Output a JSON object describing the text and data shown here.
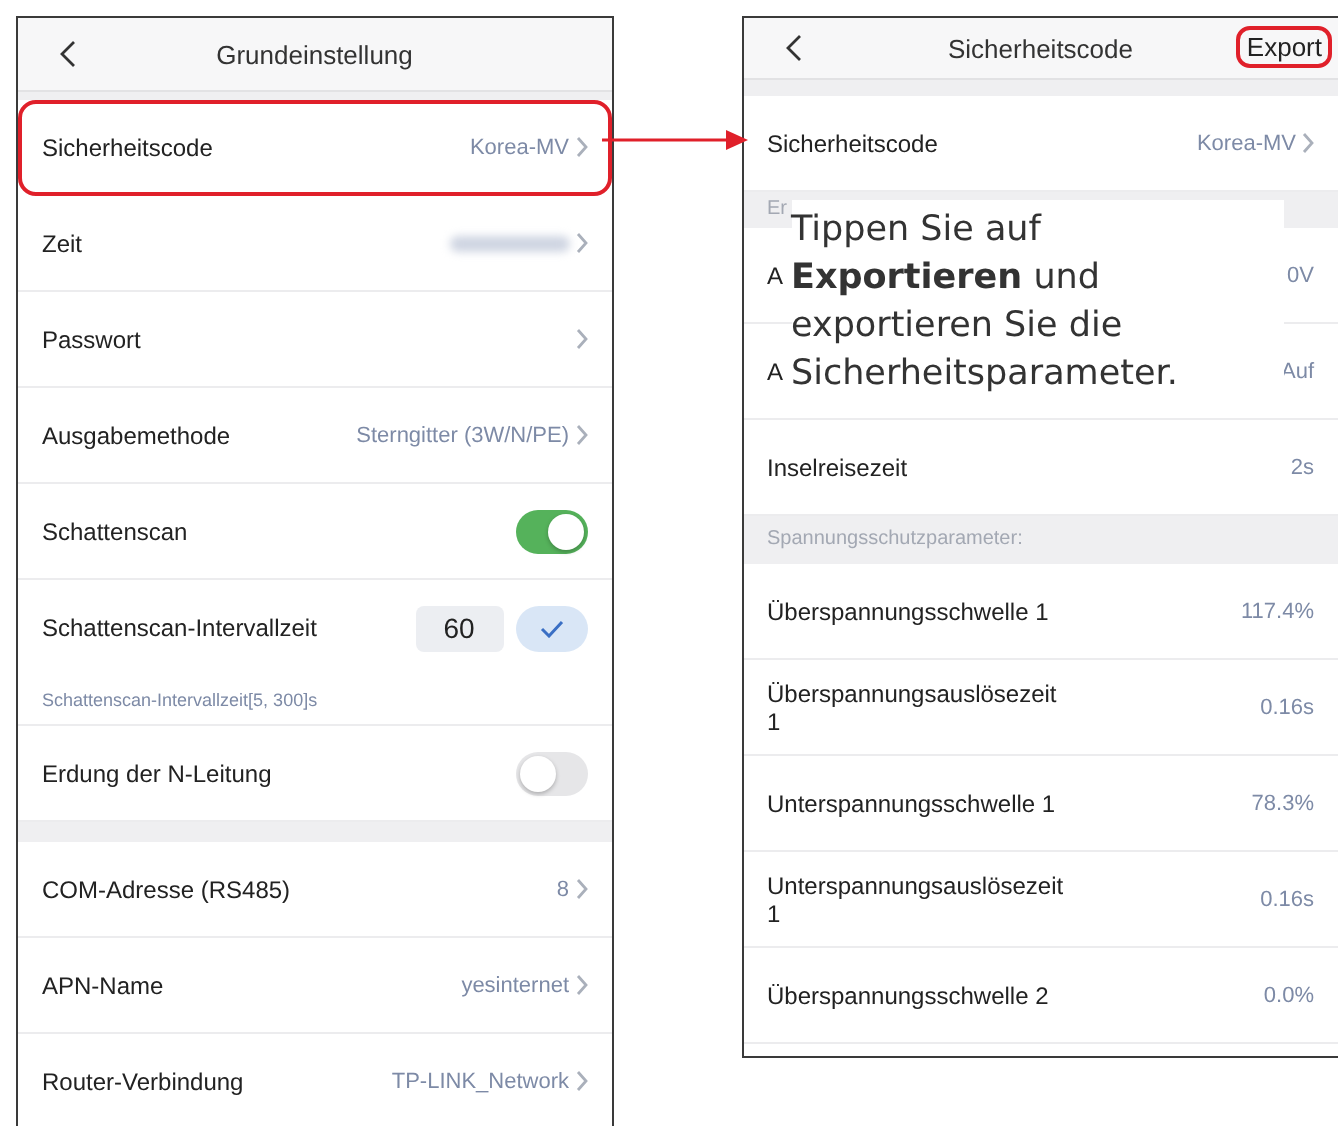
{
  "left_screen": {
    "title": "Grundeinstellung",
    "groups": [
      {
        "rows": [
          {
            "kind": "value",
            "label": "Sicherheitscode",
            "value": "Korea-MV",
            "chevron": true,
            "highlighted": true
          },
          {
            "kind": "blurred",
            "label": "Zeit",
            "chevron": true,
            "highlighted": false
          },
          {
            "kind": "value",
            "label": "Passwort",
            "chevron": true,
            "highlighted": false
          },
          {
            "kind": "value",
            "label": "Ausgabemethode",
            "value": "Sterngitter (3W/N/PE)",
            "chevron": true,
            "highlighted": false
          },
          {
            "kind": "toggle",
            "label": "Schattenscan",
            "on": true
          },
          {
            "kind": "number",
            "label": "Schattenscan-Intervallzeit",
            "value": "60",
            "hint": "Schattenscan-Intervallzeit[5, 300]s"
          },
          {
            "kind": "toggle",
            "label": "Erdung der N-Leitung",
            "on": false
          }
        ]
      },
      {
        "rows": [
          {
            "kind": "value",
            "label": "COM-Adresse (RS485)",
            "value": "8",
            "chevron": true,
            "highlighted": false
          },
          {
            "kind": "value",
            "label": "APN-Name",
            "value": "yesinternet",
            "chevron": true,
            "highlighted": false
          },
          {
            "kind": "value",
            "label": "Router-Verbindung",
            "value": "TP-LINK_Network",
            "chevron": true,
            "highlighted": false
          }
        ]
      }
    ]
  },
  "right_screen": {
    "title": "Sicherheitscode",
    "action": "Export",
    "action_highlighted": true,
    "items": [
      {
        "kind": "row",
        "label": "Sicherheitscode",
        "value": "Korea-MV",
        "chevron": true
      },
      {
        "kind": "section",
        "label": "Er"
      },
      {
        "kind": "row",
        "label": "A",
        "value": "0V",
        "chevron": false
      },
      {
        "kind": "row",
        "label": "A",
        "value": "Auf",
        "chevron": false
      },
      {
        "kind": "row",
        "label": "Inselreisezeit",
        "value": "2s",
        "chevron": false
      },
      {
        "kind": "section",
        "label": "Spannungsschutzparameter:"
      },
      {
        "kind": "row",
        "label": "Überspannungsschwelle 1",
        "value": "117.4%",
        "chevron": false
      },
      {
        "kind": "row",
        "label": "Überspannungsauslösezeit\n1",
        "value": "0.16s",
        "chevron": false
      },
      {
        "kind": "row",
        "label": "Unterspannungsschwelle 1",
        "value": "78.3%",
        "chevron": false
      },
      {
        "kind": "row",
        "label": "Unterspannungsauslösezeit\n1",
        "value": "0.16s",
        "chevron": false
      },
      {
        "kind": "row",
        "label": "Überspannungsschwelle 2",
        "value": "0.0%",
        "chevron": false
      }
    ]
  },
  "callout": "Tippen Sie auf\n**Exportieren** und\nexportieren Sie die\nSicherheitsparameter."
}
